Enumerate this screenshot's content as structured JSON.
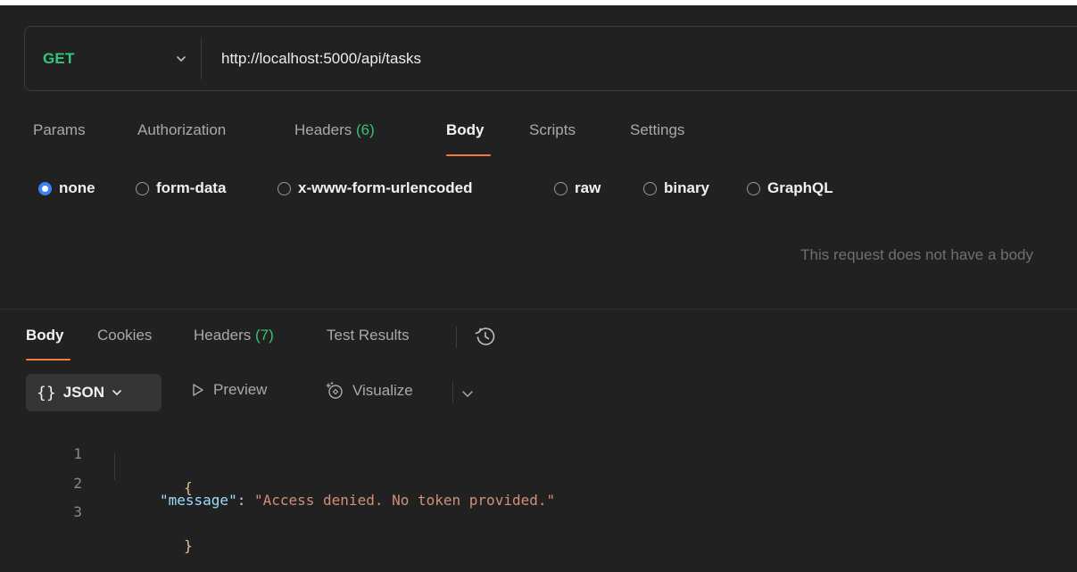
{
  "request": {
    "method": "GET",
    "url": "http://localhost:5000/api/tasks"
  },
  "request_tabs": [
    {
      "label": "Params"
    },
    {
      "label": "Authorization"
    },
    {
      "label": "Headers",
      "count": "(6)"
    },
    {
      "label": "Body",
      "active": true
    },
    {
      "label": "Scripts"
    },
    {
      "label": "Settings"
    }
  ],
  "body_types": [
    {
      "label": "none",
      "selected": true
    },
    {
      "label": "form-data"
    },
    {
      "label": "x-www-form-urlencoded"
    },
    {
      "label": "raw"
    },
    {
      "label": "binary"
    },
    {
      "label": "GraphQL"
    }
  ],
  "no_body_message": "This request does not have a body",
  "response_tabs": [
    {
      "label": "Body",
      "active": true
    },
    {
      "label": "Cookies"
    },
    {
      "label": "Headers",
      "count": "(7)"
    },
    {
      "label": "Test Results"
    }
  ],
  "response_toolbar": {
    "format_braces": "{}",
    "format_label": "JSON",
    "preview_label": "Preview",
    "visualize_label": "Visualize"
  },
  "response_body": {
    "lines": [
      {
        "number": "1",
        "open_brace": "{"
      },
      {
        "number": "2",
        "key": "\"message\"",
        "colon": ": ",
        "value": "\"Access denied. No token provided.\""
      },
      {
        "number": "3",
        "close_brace": "}"
      }
    ]
  },
  "colors": {
    "method_get": "#33c481",
    "tab_underline": "#f07b3f",
    "radio_selected": "#3b82f6",
    "json_key": "#9cdcfe",
    "json_string": "#ce9178"
  },
  "icons": {
    "method_dropdown": "chevron-down-icon",
    "history": "history-icon",
    "preview": "play-outline-icon",
    "visualize": "visualize-icon",
    "more": "chevron-down-icon"
  }
}
